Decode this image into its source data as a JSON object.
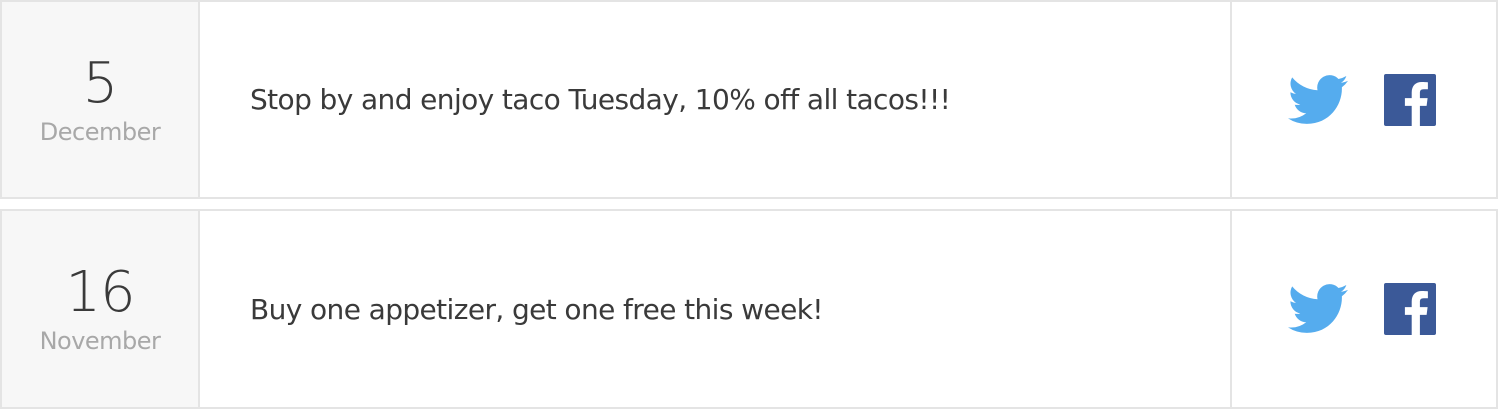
{
  "posts": [
    {
      "day": "5",
      "month": "December",
      "message": "Stop by and enjoy taco Tuesday, 10% off all tacos!!!",
      "share": {
        "twitter_icon": "twitter-bird-icon",
        "facebook_icon": "facebook-f-icon"
      }
    },
    {
      "day": "16",
      "month": "November",
      "message": "Buy one appetizer, get one free this week!",
      "share": {
        "twitter_icon": "twitter-bird-icon",
        "facebook_icon": "facebook-f-icon"
      }
    }
  ],
  "colors": {
    "twitter": "#55acee",
    "facebook": "#3b5998",
    "border": "#e4e4e4",
    "date_bg": "#f7f7f7",
    "day_text": "#3a3a3a",
    "month_text": "#a8a8a8"
  }
}
